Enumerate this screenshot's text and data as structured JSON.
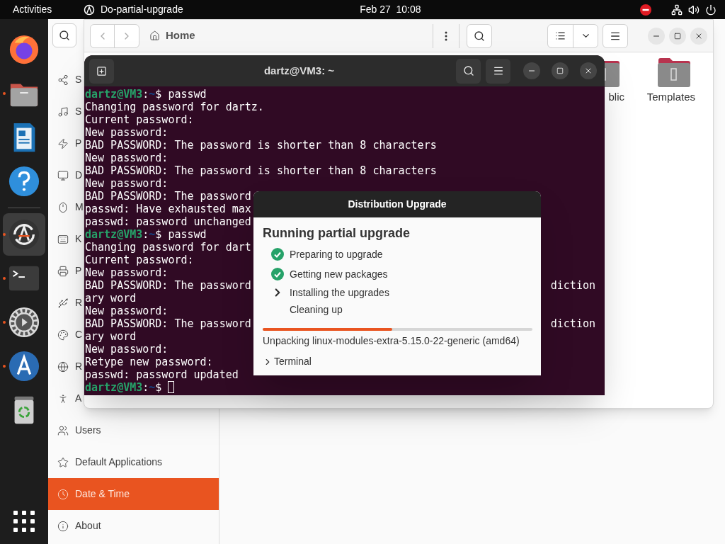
{
  "top_bar": {
    "activities": "Activities",
    "app_name": "Do-partial-upgrade",
    "clock": "Feb 27  10:08"
  },
  "dock": {
    "items": [
      {
        "running": false,
        "selected": false
      },
      {
        "running": true,
        "selected": false
      },
      {
        "running": false,
        "selected": false
      },
      {
        "running": false,
        "selected": false
      },
      {
        "running": true,
        "selected": true
      },
      {
        "running": true,
        "selected": false
      },
      {
        "running": true,
        "selected": false
      },
      {
        "running": true,
        "selected": false
      },
      {
        "running": false,
        "selected": false
      }
    ]
  },
  "settings": {
    "sidebar": [
      {
        "label": "S",
        "selected": false
      },
      {
        "label": "S",
        "selected": false
      },
      {
        "label": "P",
        "selected": false
      },
      {
        "label": "D",
        "selected": false
      },
      {
        "label": "M",
        "selected": false
      },
      {
        "label": "K",
        "selected": false
      },
      {
        "label": "P",
        "selected": false
      },
      {
        "label": "R",
        "selected": false
      },
      {
        "label": "C",
        "selected": false
      },
      {
        "label": "R",
        "selected": false
      },
      {
        "label": "A",
        "selected": false
      },
      {
        "label": "Users",
        "selected": false
      },
      {
        "label": "Default Applications",
        "selected": false
      },
      {
        "label": "Date & Time",
        "selected": true
      },
      {
        "label": "About",
        "selected": false
      }
    ]
  },
  "files_window": {
    "path": "Home",
    "folders": [
      {
        "label": "blic"
      },
      {
        "label": "Templates"
      }
    ]
  },
  "terminal": {
    "title": "dartz@VM3: ~",
    "lines": [
      {
        "kind": "prompt",
        "user": "dartz@VM3",
        "sep": ":",
        "path": "~",
        "symbol": "$",
        "command": "passwd",
        "cursor": false
      },
      {
        "kind": "output",
        "text": "Changing password for dartz."
      },
      {
        "kind": "output",
        "text": "Current password:"
      },
      {
        "kind": "output",
        "text": "New password:"
      },
      {
        "kind": "output",
        "text": "BAD PASSWORD: The password is shorter than 8 characters"
      },
      {
        "kind": "output",
        "text": "New password:"
      },
      {
        "kind": "output",
        "text": "BAD PASSWORD: The password is shorter than 8 characters"
      },
      {
        "kind": "output",
        "text": "New password:"
      },
      {
        "kind": "output",
        "text": "BAD PASSWORD: The password"
      },
      {
        "kind": "output",
        "text": "passwd: Have exhausted max"
      },
      {
        "kind": "output",
        "text": "passwd: password unchanged"
      },
      {
        "kind": "prompt",
        "user": "dartz@VM3",
        "sep": ":",
        "path": "~",
        "symbol": "$",
        "command": "passwd",
        "cursor": false
      },
      {
        "kind": "output",
        "text": "Changing password for dart"
      },
      {
        "kind": "output",
        "text": "Current password:"
      },
      {
        "kind": "output",
        "text": "New password:"
      },
      {
        "kind": "output",
        "text": "BAD PASSWORD: The password",
        "tail": "diction"
      },
      {
        "kind": "output",
        "text": "ary word"
      },
      {
        "kind": "output",
        "text": "New password:"
      },
      {
        "kind": "output",
        "text": "BAD PASSWORD: The password",
        "tail": "diction"
      },
      {
        "kind": "output",
        "text": "ary word"
      },
      {
        "kind": "output",
        "text": "New password:"
      },
      {
        "kind": "output",
        "text": "Retype new password:"
      },
      {
        "kind": "output",
        "text": "passwd: password updated"
      },
      {
        "kind": "prompt",
        "user": "dartz@VM3",
        "sep": ":",
        "path": "~",
        "symbol": "$",
        "cursor": true
      }
    ]
  },
  "dialog": {
    "title": "Distribution Upgrade",
    "heading": "Running partial upgrade",
    "steps": [
      {
        "label": "Preparing to upgrade",
        "done": true,
        "current": false
      },
      {
        "label": "Getting new packages",
        "done": true,
        "current": false
      },
      {
        "label": "Installing the upgrades",
        "done": false,
        "current": true
      },
      {
        "label": "Cleaning up",
        "done": false,
        "current": false
      }
    ],
    "progress": {
      "level": 0.48
    },
    "status": "Unpacking linux-modules-extra-5.15.0-22-generic (amd64)",
    "expander": {
      "label": "Terminal",
      "expanded": false
    }
  }
}
